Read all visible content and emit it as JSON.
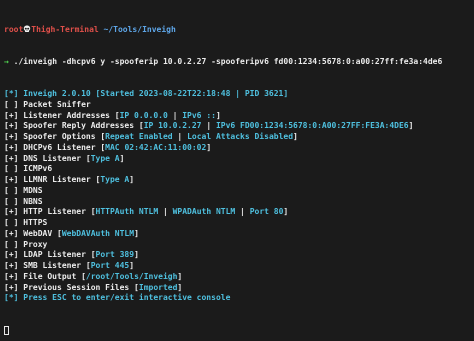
{
  "prompt": {
    "user": "root",
    "host": "Thigh-Terminal",
    "path": "~/Tools/Inveigh",
    "skull_icon": "skull-icon",
    "arrow_icon": "arrow-right-icon"
  },
  "command": "./inveigh -dhcpv6 y -spooferip 10.0.2.27 -spooferipv6 fd00:1234:5678:0:a00:27ff:fe3a:4de6",
  "colors": {
    "background": "#1b1b1b",
    "text": "#e8e8e8",
    "prompt_red": "#e0504a",
    "path_blue": "#5ea6e8",
    "green": "#4fd14f",
    "cyan": "#4fc1e0"
  },
  "lines": [
    {
      "prefix": "[*]",
      "tone": "cyan",
      "segments": [
        {
          "text": "Inveigh 2.0.10 [Started 2023-08-22T22:18:48 | PID 3621]",
          "tone": "cyan"
        }
      ]
    },
    {
      "prefix": "[ ]",
      "tone": "white",
      "segments": [
        {
          "text": "Packet Sniffer",
          "tone": "white"
        }
      ]
    },
    {
      "prefix": "[+]",
      "tone": "white",
      "segments": [
        {
          "text": "Listener Addresses [",
          "tone": "white"
        },
        {
          "text": "IP 0.0.0.0",
          "tone": "cyan"
        },
        {
          "text": " | ",
          "tone": "white"
        },
        {
          "text": "IPv6 ::",
          "tone": "cyan"
        },
        {
          "text": "]",
          "tone": "white"
        }
      ]
    },
    {
      "prefix": "[+]",
      "tone": "white",
      "segments": [
        {
          "text": "Spoofer Reply Addresses [",
          "tone": "white"
        },
        {
          "text": "IP 10.0.2.27",
          "tone": "cyan"
        },
        {
          "text": " | ",
          "tone": "white"
        },
        {
          "text": "IPv6 FD00:1234:5678:0:A00:27FF:FE3A:4DE6",
          "tone": "cyan"
        },
        {
          "text": "]",
          "tone": "white"
        }
      ]
    },
    {
      "prefix": "[+]",
      "tone": "white",
      "segments": [
        {
          "text": "Spoofer Options [",
          "tone": "white"
        },
        {
          "text": "Repeat Enabled",
          "tone": "cyan"
        },
        {
          "text": " | ",
          "tone": "white"
        },
        {
          "text": "Local Attacks Disabled",
          "tone": "cyan"
        },
        {
          "text": "]",
          "tone": "white"
        }
      ]
    },
    {
      "prefix": "[+]",
      "tone": "white",
      "segments": [
        {
          "text": "DHCPv6 Listener [",
          "tone": "white"
        },
        {
          "text": "MAC 02:42:AC:11:00:02",
          "tone": "cyan"
        },
        {
          "text": "]",
          "tone": "white"
        }
      ]
    },
    {
      "prefix": "[+]",
      "tone": "white",
      "segments": [
        {
          "text": "DNS Listener [",
          "tone": "white"
        },
        {
          "text": "Type A",
          "tone": "cyan"
        },
        {
          "text": "]",
          "tone": "white"
        }
      ]
    },
    {
      "prefix": "[ ]",
      "tone": "white",
      "segments": [
        {
          "text": "ICMPv6",
          "tone": "white"
        }
      ]
    },
    {
      "prefix": "[+]",
      "tone": "white",
      "segments": [
        {
          "text": "LLMNR Listener [",
          "tone": "white"
        },
        {
          "text": "Type A",
          "tone": "cyan"
        },
        {
          "text": "]",
          "tone": "white"
        }
      ]
    },
    {
      "prefix": "[ ]",
      "tone": "white",
      "segments": [
        {
          "text": "MDNS",
          "tone": "white"
        }
      ]
    },
    {
      "prefix": "[ ]",
      "tone": "white",
      "segments": [
        {
          "text": "NBNS",
          "tone": "white"
        }
      ]
    },
    {
      "prefix": "[+]",
      "tone": "white",
      "segments": [
        {
          "text": "HTTP Listener [",
          "tone": "white"
        },
        {
          "text": "HTTPAuth NTLM",
          "tone": "cyan"
        },
        {
          "text": " | ",
          "tone": "white"
        },
        {
          "text": "WPADAuth NTLM",
          "tone": "cyan"
        },
        {
          "text": " | ",
          "tone": "white"
        },
        {
          "text": "Port 80",
          "tone": "cyan"
        },
        {
          "text": "]",
          "tone": "white"
        }
      ]
    },
    {
      "prefix": "[ ]",
      "tone": "white",
      "segments": [
        {
          "text": "HTTPS",
          "tone": "white"
        }
      ]
    },
    {
      "prefix": "[+]",
      "tone": "white",
      "segments": [
        {
          "text": "WebDAV [",
          "tone": "white"
        },
        {
          "text": "WebDAVAuth NTLM",
          "tone": "cyan"
        },
        {
          "text": "]",
          "tone": "white"
        }
      ]
    },
    {
      "prefix": "[ ]",
      "tone": "white",
      "segments": [
        {
          "text": "Proxy",
          "tone": "white"
        }
      ]
    },
    {
      "prefix": "[+]",
      "tone": "white",
      "segments": [
        {
          "text": "LDAP Listener [",
          "tone": "white"
        },
        {
          "text": "Port 389",
          "tone": "cyan"
        },
        {
          "text": "]",
          "tone": "white"
        }
      ]
    },
    {
      "prefix": "[+]",
      "tone": "white",
      "segments": [
        {
          "text": "SMB Listener [",
          "tone": "white"
        },
        {
          "text": "Port 445",
          "tone": "cyan"
        },
        {
          "text": "]",
          "tone": "white"
        }
      ]
    },
    {
      "prefix": "[+]",
      "tone": "white",
      "segments": [
        {
          "text": "File Output [",
          "tone": "white"
        },
        {
          "text": "/root/Tools/Inveigh",
          "tone": "cyan"
        },
        {
          "text": "]",
          "tone": "white"
        }
      ]
    },
    {
      "prefix": "[+]",
      "tone": "white",
      "segments": [
        {
          "text": "Previous Session Files [",
          "tone": "white"
        },
        {
          "text": "Imported",
          "tone": "cyan"
        },
        {
          "text": "]",
          "tone": "white"
        }
      ]
    },
    {
      "prefix": "[*]",
      "tone": "cyan",
      "segments": [
        {
          "text": "Press ESC to enter/exit interactive console",
          "tone": "cyan"
        }
      ]
    }
  ]
}
